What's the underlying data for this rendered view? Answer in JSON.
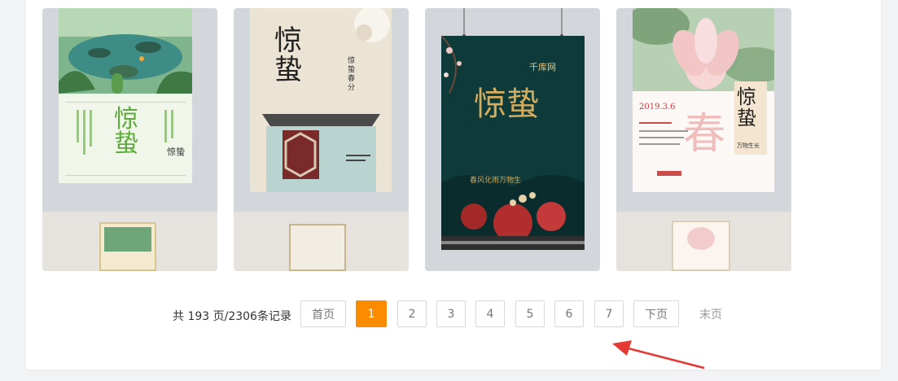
{
  "posters": [
    {
      "title": "惊蛰",
      "caption": "惊蛰"
    },
    {
      "title": "惊蛰",
      "caption": "惊蛰春分"
    },
    {
      "title": "惊蛰",
      "brand": "千库网",
      "subtitle": "春风化雨万物生"
    },
    {
      "title": "惊蛰",
      "accent": "春",
      "date": "2019.3.6",
      "tagline": "万物生长"
    }
  ],
  "pagination": {
    "summary": "共 193 页/2306条记录",
    "first": "首页",
    "pages": [
      "1",
      "2",
      "3",
      "4",
      "5",
      "6",
      "7"
    ],
    "current": "1",
    "next": "下页",
    "last": "末页"
  },
  "colors": {
    "accent": "#fb8c00",
    "annotation_arrow": "#e53935"
  }
}
